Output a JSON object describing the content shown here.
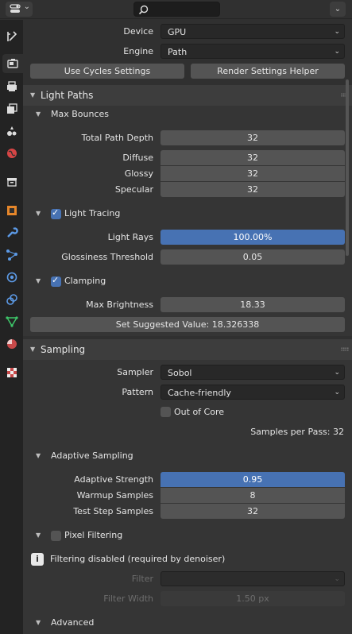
{
  "header": {
    "editor_type_icon": "properties-editor-icon",
    "search_placeholder": "",
    "menu_icon": "chevron-down-icon"
  },
  "tabs": [
    {
      "name": "tool-tab",
      "icon": "wrench-screwdriver-icon"
    },
    {
      "name": "render-tab",
      "icon": "camera-back-icon",
      "active": true
    },
    {
      "name": "output-tab",
      "icon": "printer-icon"
    },
    {
      "name": "view-layer-tab",
      "icon": "image-stack-icon"
    },
    {
      "name": "scene-tab",
      "icon": "scene-icon"
    },
    {
      "name": "world-tab",
      "icon": "world-icon"
    },
    {
      "name": "collection-tab",
      "icon": "collection-box-icon"
    },
    {
      "name": "object-tab",
      "icon": "object-square-icon"
    },
    {
      "name": "modifiers-tab",
      "icon": "wrench-icon"
    },
    {
      "name": "particles-tab",
      "icon": "particles-icon"
    },
    {
      "name": "physics-tab",
      "icon": "physics-orbit-icon"
    },
    {
      "name": "constraints-tab",
      "icon": "constraint-icon"
    },
    {
      "name": "object-data-tab",
      "icon": "mesh-triangle-icon"
    },
    {
      "name": "material-tab",
      "icon": "material-sphere-icon"
    },
    {
      "name": "texture-tab",
      "icon": "checker-texture-icon"
    }
  ],
  "top": {
    "device_label": "Device",
    "device_value": "GPU",
    "engine_label": "Engine",
    "engine_value": "Path",
    "use_cycles_btn": "Use Cycles Settings",
    "helper_btn": "Render Settings Helper"
  },
  "light_paths": {
    "title": "Light Paths",
    "max_bounces": {
      "title": "Max Bounces",
      "total_label": "Total Path Depth",
      "total_value": "32",
      "diffuse_label": "Diffuse",
      "diffuse_value": "32",
      "glossy_label": "Glossy",
      "glossy_value": "32",
      "specular_label": "Specular",
      "specular_value": "32"
    },
    "light_tracing": {
      "title": "Light Tracing",
      "enabled": true,
      "rays_label": "Light Rays",
      "rays_value": "100.00%",
      "rays_fraction": 1.0,
      "gloss_label": "Glossiness Threshold",
      "gloss_value": "0.05"
    },
    "clamping": {
      "title": "Clamping",
      "enabled": true,
      "max_label": "Max Brightness",
      "max_value": "18.33",
      "suggest_btn": "Set Suggested Value: 18.326338"
    }
  },
  "sampling": {
    "title": "Sampling",
    "sampler_label": "Sampler",
    "sampler_value": "Sobol",
    "pattern_label": "Pattern",
    "pattern_value": "Cache-friendly",
    "out_of_core_label": "Out of Core",
    "out_of_core": false,
    "samples_per_pass": "Samples per Pass: 32",
    "adaptive": {
      "title": "Adaptive Sampling",
      "strength_label": "Adaptive Strength",
      "strength_value": "0.95",
      "strength_fraction": 0.95,
      "warmup_label": "Warmup Samples",
      "warmup_value": "8",
      "test_label": "Test Step Samples",
      "test_value": "32"
    },
    "pixel_filtering": {
      "title": "Pixel Filtering",
      "enabled": false,
      "info": "Filtering disabled (required by denoiser)",
      "filter_label": "Filter",
      "filter_value": "",
      "width_label": "Filter Width",
      "width_value": "1.50 px"
    },
    "advanced_title": "Advanced"
  },
  "colors": {
    "accent": "#4772b3",
    "panel_header": "#3d3d3d",
    "background": "#303030"
  }
}
